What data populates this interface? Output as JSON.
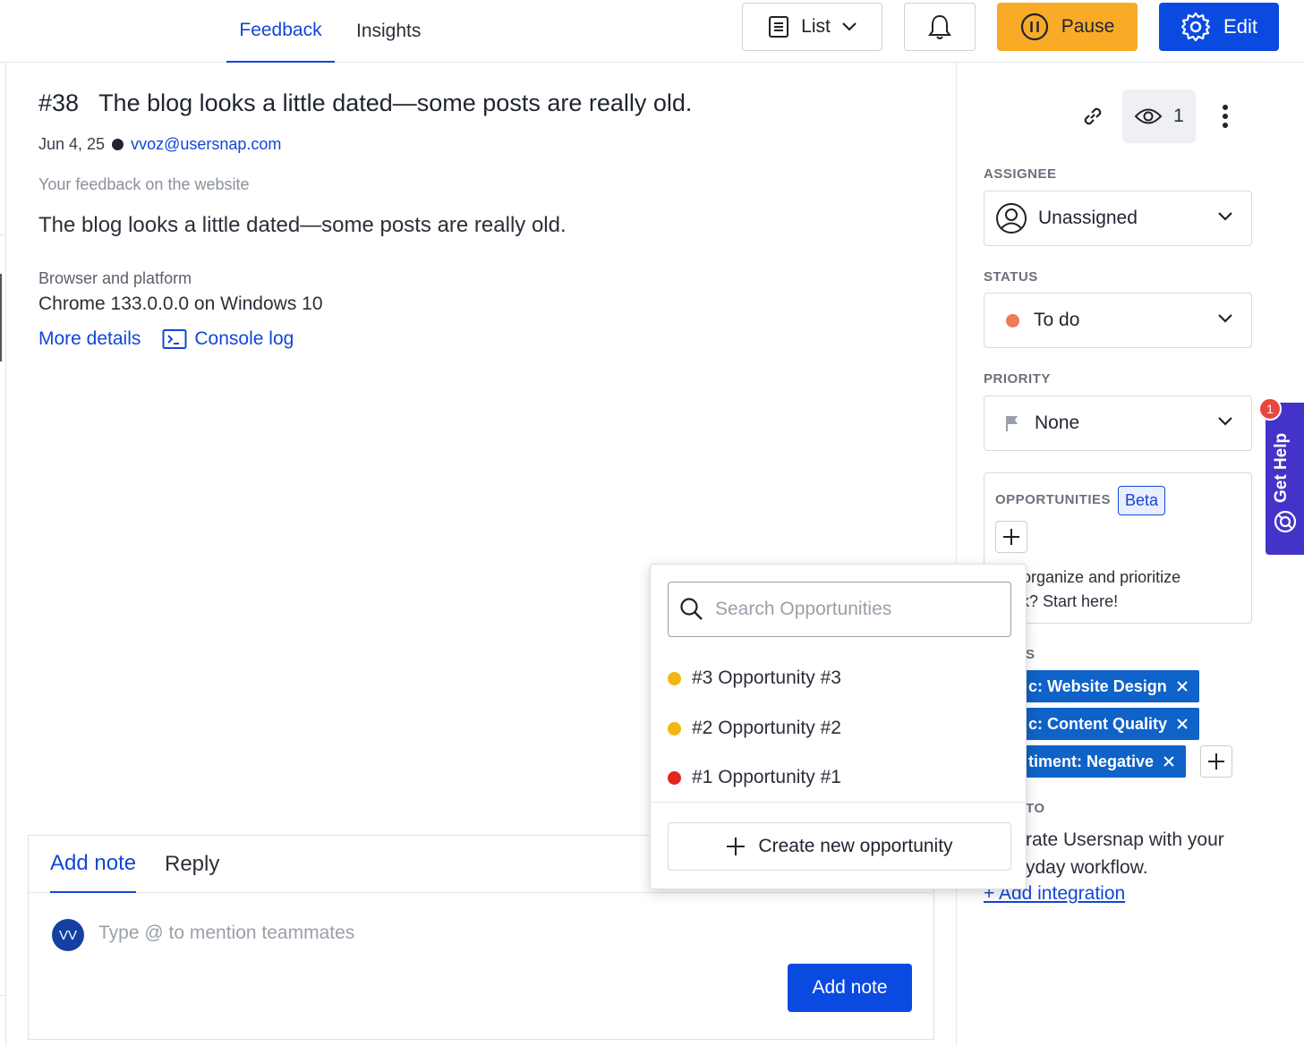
{
  "nav": {
    "tabs": [
      {
        "label": "Feedback",
        "active": true
      },
      {
        "label": "Insights",
        "active": false
      }
    ],
    "view_select": "List",
    "pause_label": "Pause",
    "edit_label": "Edit"
  },
  "colors": {
    "accent": "#0b4ae0",
    "pause": "#f9ab28",
    "status_todo": "#ef7a55",
    "tag_bg": "#0f62c7",
    "help_widget": "#4433c9"
  },
  "feedback": {
    "number": "#38",
    "title": "The blog looks a little dated—some posts are really old.",
    "date": "Jun 4, 25",
    "author_email": "vvoz@usersnap.com",
    "question_label": "Your feedback on the website",
    "answer": "The blog looks a little dated—some posts are really old.",
    "browser_label": "Browser and platform",
    "browser_value": "Chrome 133.0.0.0 on Windows 10",
    "more_details": "More details",
    "console_log": "Console log"
  },
  "composer": {
    "tab_note": "Add note",
    "tab_reply": "Reply",
    "avatar_initials": "VV",
    "placeholder": "Type @ to mention teammates",
    "submit_label": "Add note"
  },
  "sidebar": {
    "viewer_count": "1",
    "assignee_label": "ASSIGNEE",
    "assignee_value": "Unassigned",
    "status_label": "STATUS",
    "status_value": "To do",
    "priority_label": "PRIORITY",
    "priority_value": "None",
    "opportunities_label": "OPPORTUNITIES",
    "opportunities_badge": "Beta",
    "opportunities_hint": "t to organize and prioritize\nback? Start here!",
    "tags_label_partial": "S",
    "tags": [
      {
        "label": "c: Website Design"
      },
      {
        "label": "c: Content Quality"
      },
      {
        "label": "timent: Negative"
      }
    ],
    "integration_label_partial": "TO",
    "integration_text": "rate Usersnap with your\nyday workflow.",
    "integration_link": "+ Add integration"
  },
  "help_widget": {
    "label": "Get Help",
    "badge": "1"
  },
  "opportunity_popover": {
    "search_placeholder": "Search Opportunities",
    "items": [
      {
        "label": "#3 Opportunity #3",
        "color": "#f2b70f"
      },
      {
        "label": "#2 Opportunity #2",
        "color": "#f2b70f"
      },
      {
        "label": "#1 Opportunity #1",
        "color": "#e5261f"
      }
    ],
    "create_label": "Create new opportunity"
  }
}
